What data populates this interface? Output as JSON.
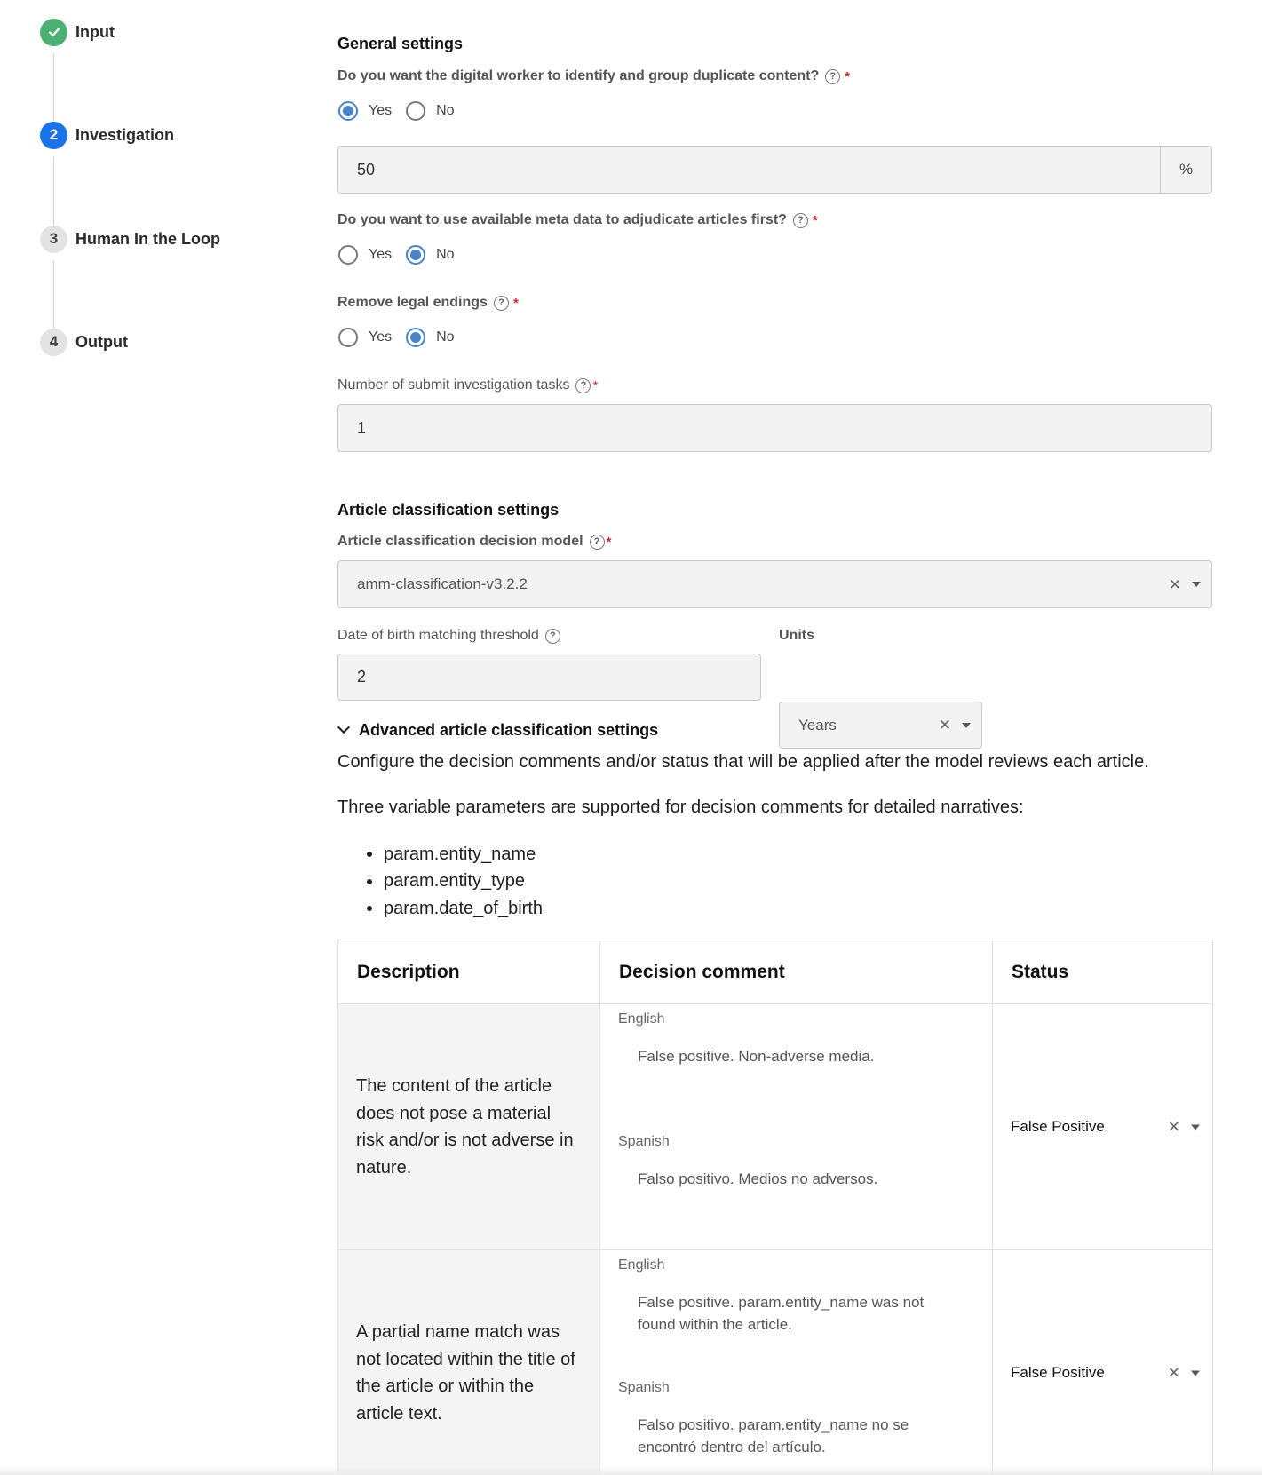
{
  "stepper": {
    "steps": [
      {
        "number": "✓",
        "label": "Input",
        "state": "done"
      },
      {
        "number": "2",
        "label": "Investigation",
        "state": "active"
      },
      {
        "number": "3",
        "label": "Human In the Loop",
        "state": "pending"
      },
      {
        "number": "4",
        "label": "Output",
        "state": "pending"
      }
    ]
  },
  "general": {
    "title": "General settings",
    "duplicate": {
      "question": "Do you want the digital worker to identify and group duplicate content?",
      "required": "*",
      "yes": "Yes",
      "no": "No",
      "selected": "Yes",
      "value": "50",
      "suffix": "%"
    },
    "metadata": {
      "question": "Do you want to use available meta data to adjudicate articles first?",
      "required": "*",
      "yes": "Yes",
      "no": "No",
      "selected": "No"
    },
    "legal": {
      "question": "Remove legal endings",
      "required": "*",
      "yes": "Yes",
      "no": "No",
      "selected": "No"
    },
    "tasks": {
      "label": "Number of submit investigation tasks",
      "required": "*",
      "value": "1"
    }
  },
  "classification": {
    "title": "Article classification settings",
    "model": {
      "label": "Article classification decision model",
      "required": "*",
      "value": "amm-classification-v3.2.2"
    },
    "dob": {
      "label": "Date of birth matching threshold",
      "value": "2"
    },
    "units": {
      "label": "Units",
      "value": "Years"
    }
  },
  "advanced": {
    "title": "Advanced article classification settings",
    "intro": "Configure the decision comments and/or status that will be applied after the model reviews each article.",
    "params_intro": "Three variable parameters are supported for decision comments for detailed narratives:",
    "params": [
      "param.entity_name",
      "param.entity_type",
      "param.date_of_birth"
    ],
    "table": {
      "headers": {
        "description": "Description",
        "comment": "Decision comment",
        "status": "Status"
      },
      "rows": [
        {
          "description": "The content of the article does not pose a material risk and/or is not adverse in nature.",
          "english_label": "English",
          "english": "False positive. Non-adverse media.",
          "spanish_label": "Spanish",
          "spanish": "Falso positivo. Medios no adversos.",
          "status": "False Positive"
        },
        {
          "description": "A partial name match was not located within the title of the article or within the article text.",
          "english_label": "English",
          "english": "False positive. param.entity_name was not found within the article.",
          "spanish_label": "Spanish",
          "spanish": "Falso positivo. param.entity_name no se encontró dentro del artículo.",
          "status": "False Positive"
        }
      ]
    }
  },
  "colors": {
    "accent": "#1a73e8",
    "radio_selected": "#4a84c8",
    "step_done": "#4caf73",
    "required": "#c62828"
  }
}
